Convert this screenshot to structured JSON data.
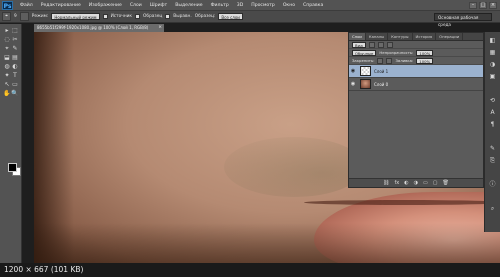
{
  "menubar": {
    "logo": "Ps",
    "items": [
      "Файл",
      "Редактирование",
      "Изображение",
      "Слои",
      "Шрифт",
      "Выделение",
      "Фильтр",
      "3D",
      "Просмотр",
      "Окно",
      "Справка"
    ],
    "window_controls": [
      "–",
      "□",
      "×"
    ]
  },
  "options": {
    "tool_icon": "⌖",
    "label_size": "9",
    "label_style": "Нормальный режим",
    "mode_label": "Режим:",
    "source_label": "Источник",
    "source_value": "Образец",
    "aligned_label": "Выравн.",
    "sample_label": "Образец:",
    "sample_value": "Все слои",
    "workspace": "Основная рабочая среда"
  },
  "document": {
    "tab_title": "8655b51f299f-1920x1080.jpg @ 100% (Слой 1, RGB/8)",
    "close": "×"
  },
  "toolbar": {
    "tools": [
      "▸",
      "⬚",
      "◌",
      "✂",
      "⌖",
      "✎",
      "⬓",
      "▤",
      "◍",
      "◐",
      "✦",
      "T",
      "↖",
      "▭",
      "✋",
      "🔍"
    ]
  },
  "layers_panel": {
    "tabs": [
      "Слои",
      "Каналы",
      "Контуры",
      "История",
      "Операции"
    ],
    "filter_label": "Вид",
    "blend_mode": "Обычные",
    "opacity_label": "Непрозрачность:",
    "opacity_value": "100%",
    "lock_label": "Закрепить:",
    "fill_label": "Заливка:",
    "fill_value": "100%",
    "layers": [
      {
        "name": "Слой 1",
        "selected": true,
        "thumb": "empty"
      },
      {
        "name": "Слой 0",
        "selected": false,
        "thumb": "photo"
      }
    ],
    "footer_icons": [
      "⛓",
      "fx",
      "◐",
      "◑",
      "▭",
      "▢",
      "🗑"
    ]
  },
  "status": {
    "text": "1200 × 667 (101 KB)"
  },
  "colors": {
    "selection": "#9bb2cf",
    "ui_dark": "#535353"
  }
}
